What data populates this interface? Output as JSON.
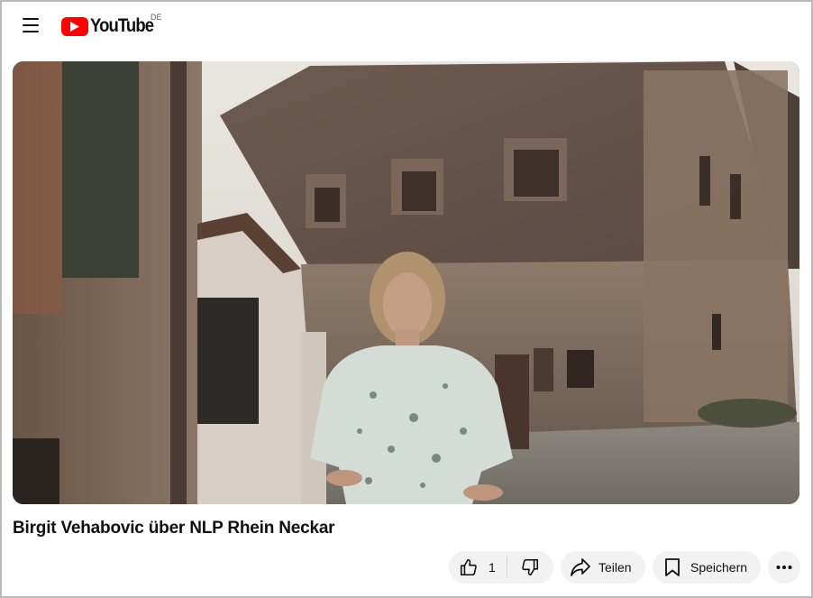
{
  "header": {
    "menu_icon": "hamburger-menu-icon",
    "logo_text": "YouTube",
    "region_code": "DE",
    "brand_color": "#ff0000"
  },
  "video": {
    "title": "Birgit Vehabovic über NLP Rhein Neckar"
  },
  "actions": {
    "like_count": "1",
    "share_label": "Teilen",
    "save_label": "Speichern",
    "like_icon": "thumbs-up-icon",
    "dislike_icon": "thumbs-down-icon",
    "share_icon": "share-arrow-icon",
    "save_icon": "bookmark-icon",
    "more_icon": "more-horizontal-icon"
  }
}
